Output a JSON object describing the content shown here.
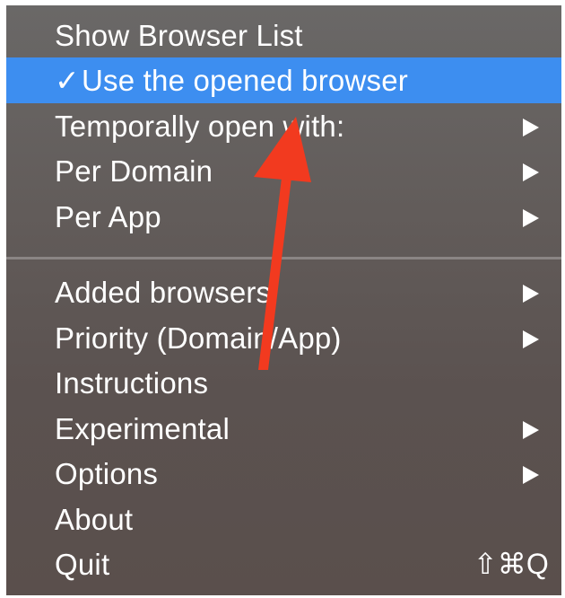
{
  "menu": {
    "items": [
      {
        "label": "Show Browser List",
        "checked": false,
        "submenu": false
      },
      {
        "label": "Use the opened browser",
        "checked": true,
        "submenu": false,
        "selected": true
      },
      {
        "label": "Temporally open with:",
        "checked": false,
        "submenu": true
      },
      {
        "label": "Per Domain",
        "checked": false,
        "submenu": true
      },
      {
        "label": "Per App",
        "checked": false,
        "submenu": true
      },
      {
        "label": "Added browsers",
        "checked": false,
        "submenu": true
      },
      {
        "label": "Priority (Domain/App)",
        "checked": false,
        "submenu": true
      },
      {
        "label": "Instructions",
        "checked": false,
        "submenu": false
      },
      {
        "label": "Experimental",
        "checked": false,
        "submenu": true
      },
      {
        "label": "Options",
        "checked": false,
        "submenu": true
      },
      {
        "label": "About",
        "checked": false,
        "submenu": false
      },
      {
        "label": "Quit",
        "checked": false,
        "submenu": false,
        "shortcut": "⇧⌘Q"
      }
    ],
    "check_glyph": "✓"
  },
  "colors": {
    "menu_background": "#625c5a",
    "highlight": "#3d8ef0",
    "text": "#ffffff",
    "annotation_arrow": "#f23a1f"
  }
}
